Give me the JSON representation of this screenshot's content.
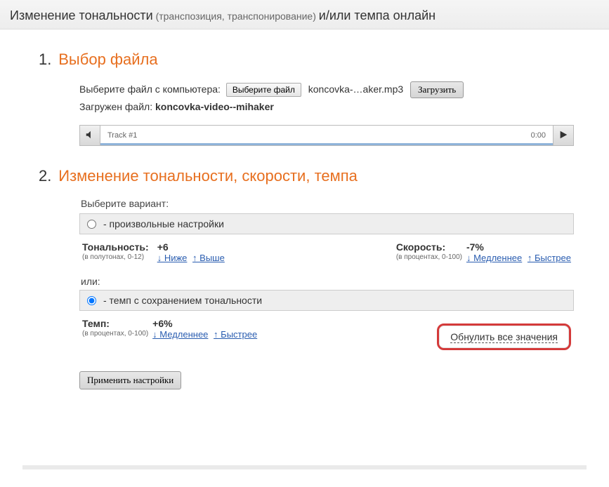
{
  "header": {
    "title_main": "Изменение тональности",
    "title_paren": "(транспозиция, транспонирование)",
    "title_tail": "и/или темпа онлайн"
  },
  "step1": {
    "num": "1.",
    "title": "Выбор файла",
    "select_label": "Выберите файл с компьютера:",
    "browse_btn": "Выберите файл",
    "filename_short": "koncovka-…aker.mp3",
    "upload_btn": "Загрузить",
    "loaded_label": "Загружен файл:",
    "loaded_file": "koncovka-video--mihaker",
    "track_name": "Track #1",
    "track_time": "0:00"
  },
  "step2": {
    "num": "2.",
    "title": "Изменение тональности, скорости, темпа",
    "choose_variant": "Выберите вариант:",
    "opt_custom": "- произвольные настройки",
    "tone": {
      "label": "Тональность:",
      "value": "+6",
      "note": "(в полутонах, 0-12)",
      "down": "↓ Ниже",
      "up": "↑ Выше"
    },
    "speed": {
      "label": "Скорость:",
      "value": "-7%",
      "note": "(в процентах, 0-100)",
      "down": "↓ Медленнее",
      "up": "↑ Быстрее"
    },
    "or_label": "или:",
    "opt_tempo": "- темп с сохранением тональности",
    "tempo": {
      "label": "Темп:",
      "value": "+6%",
      "note": "(в процентах, 0-100)",
      "down": "↓ Медленнее",
      "up": "↑ Быстрее"
    },
    "reset": "Обнулить все значения",
    "apply": "Применить настройки"
  }
}
